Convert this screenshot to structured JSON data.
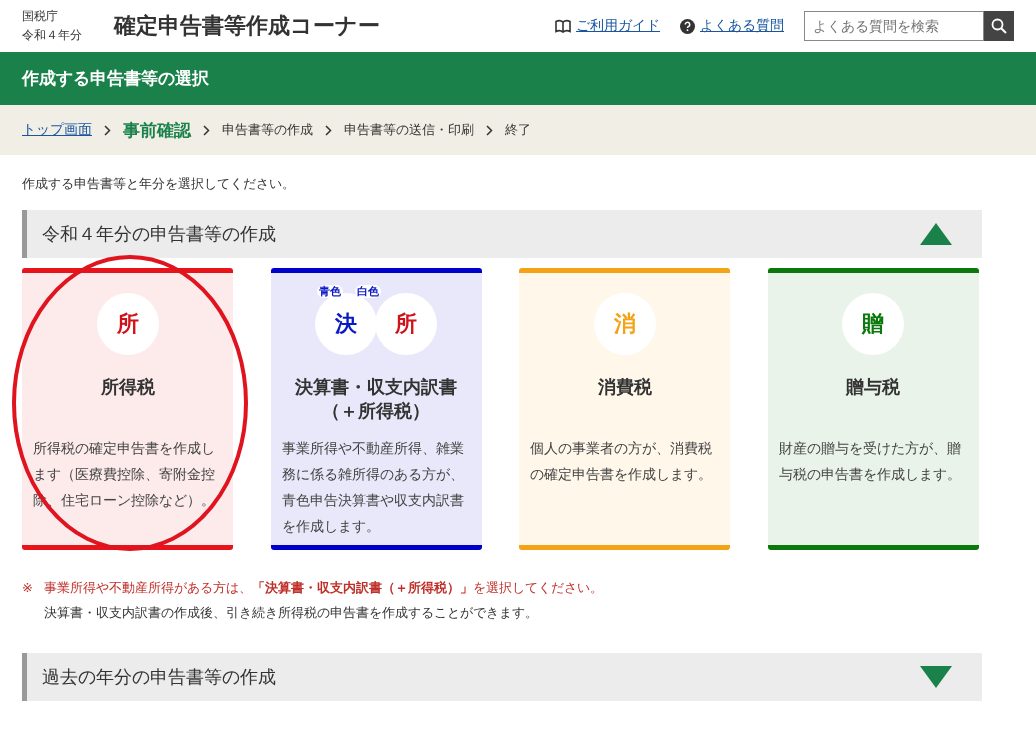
{
  "header": {
    "agency": "国税庁",
    "year": "令和４年分",
    "title": "確定申告書等作成コーナー",
    "links": [
      {
        "kind": "guide",
        "label": "ご利用ガイド"
      },
      {
        "kind": "faq",
        "label": "よくある質問"
      }
    ],
    "search": {
      "placeholder": "よくある質問を検索"
    }
  },
  "page_title": "作成する申告書等の選択",
  "breadcrumb": [
    {
      "kind": "link",
      "label": "トップ画面"
    },
    {
      "kind": "current",
      "label": "事前確認"
    },
    {
      "kind": "step",
      "label": "申告書等の作成"
    },
    {
      "kind": "step",
      "label": "申告書等の送信・印刷"
    },
    {
      "kind": "step",
      "label": "終了"
    }
  ],
  "intro": "作成する申告書等と年分を選択してください。",
  "sections": [
    {
      "title": "令和４年分の申告書等の作成",
      "expanded": true,
      "cards": [
        {
          "color": "#e8131b",
          "highlighted": true,
          "badges": [
            {
              "char": "所",
              "color": "#d0121b"
            }
          ],
          "title": "所得税",
          "description": "所得税の確定申告書を作成します（医療費控除、寄附金控除、住宅ローン控除など）。"
        },
        {
          "color": "#0000cc",
          "highlighted": false,
          "badges": [
            {
              "char": "決",
              "color": "#0a18c8",
              "tag": "青色"
            },
            {
              "char": "所",
              "color": "#d0121b",
              "tag": "白色"
            }
          ],
          "title": "決算書・収支内訳書（＋所得税）",
          "description": "事業所得や不動産所得、雑業務に係る雑所得のある方が、青色申告決算書や収支内訳書を作成します。"
        },
        {
          "color": "#f5a316",
          "highlighted": false,
          "badges": [
            {
              "char": "消",
              "color": "#f5a316"
            }
          ],
          "title": "消費税",
          "description": "個人の事業者の方が、消費税の確定申告書を作成します。"
        },
        {
          "color": "#0a780a",
          "highlighted": false,
          "badges": [
            {
              "char": "贈",
              "color": "#0a780a"
            }
          ],
          "title": "贈与税",
          "description": "財産の贈与を受けた方が、贈与税の申告書を作成します。"
        }
      ],
      "notes": {
        "mark": "※",
        "lines": [
          {
            "kind": "warning",
            "text": "事業所得や不動産所得がある方は、**「決算書・収支内訳書（＋所得税）」**を選択してください。"
          },
          {
            "kind": "plain",
            "text": "決算書・収支内訳書の作成後、引き続き所得税の申告書を作成することができます。"
          }
        ]
      }
    },
    {
      "title": "過去の年分の申告書等の作成",
      "expanded": false
    }
  ]
}
